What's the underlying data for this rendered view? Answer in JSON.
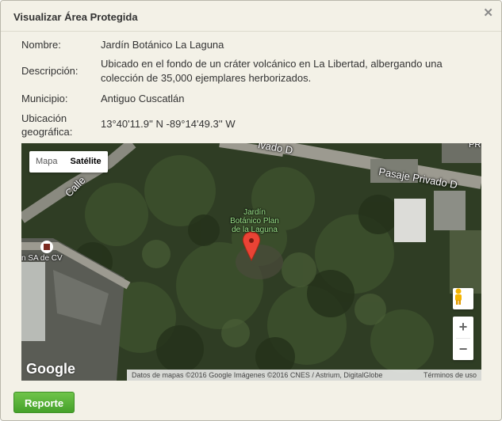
{
  "dialog": {
    "title": "Visualizar Área Protegida",
    "close_icon": "close-icon"
  },
  "fields": {
    "nombre_label": "Nombre:",
    "nombre_value": "Jardín Botánico La Laguna",
    "descripcion_label": "Descripción:",
    "descripcion_value": "Ubicado en el fondo de un cráter volcánico en La Libertad, albergando una colección de 35,000 ejemplares herborizados.",
    "municipio_label": "Municipio:",
    "municipio_value": "Antiguo Cuscatlán",
    "ubicacion_label_1": "Ubicación",
    "ubicacion_label_2": "geográfica:",
    "ubicacion_value": "13°40'11.9'' N -89°14'49.3'' W"
  },
  "map": {
    "map_type_options": [
      "Mapa",
      "Satélite"
    ],
    "selected_map_type": "Satélite",
    "place_label_lines": [
      "Jardín",
      "Botánico Plan",
      "de la Laguna"
    ],
    "street_1": "Pasaje Privado D",
    "street_2": "ivado D",
    "street_3": "Calle",
    "street_4": "PR",
    "poi_label": "n SA de CV",
    "zoom_in": "+",
    "zoom_out": "−",
    "google_logo": "Google",
    "attribution": "Datos de mapas ©2016 Google Imágenes ©2016 CNES / Astrium, DigitalGlobe",
    "terms": "Términos de uso",
    "accent_marker_color": "#ea4335"
  },
  "footer": {
    "report_label": "Reporte",
    "report_color": "#4caf2e"
  }
}
